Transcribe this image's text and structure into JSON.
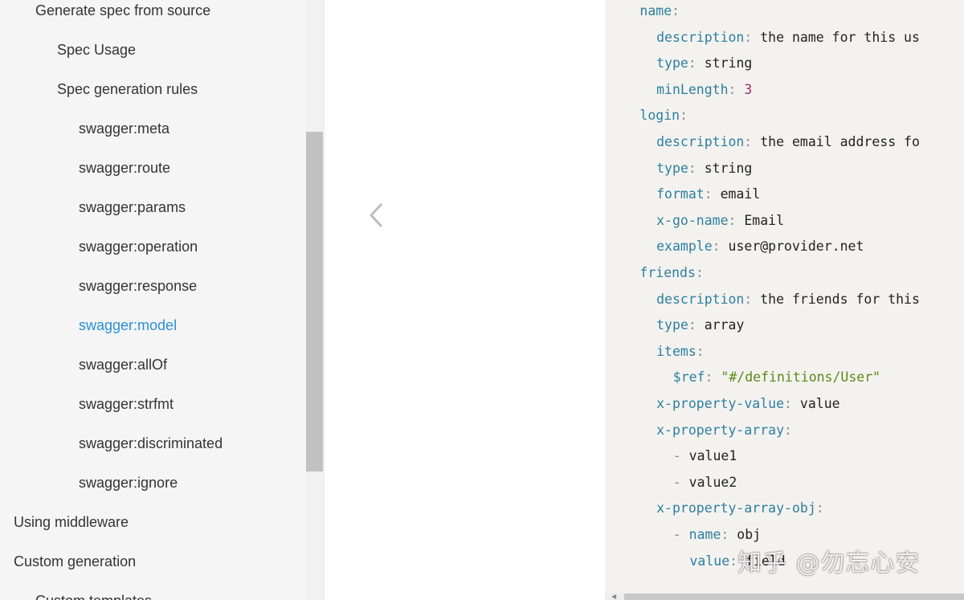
{
  "sidebar": {
    "items": [
      {
        "label": "Generate spec from source",
        "level": 2
      },
      {
        "label": "Spec Usage",
        "level": 3
      },
      {
        "label": "Spec generation rules",
        "level": 3
      },
      {
        "label": "swagger:meta",
        "level": 4
      },
      {
        "label": "swagger:route",
        "level": 4
      },
      {
        "label": "swagger:params",
        "level": 4
      },
      {
        "label": "swagger:operation",
        "level": 4
      },
      {
        "label": "swagger:response",
        "level": 4
      },
      {
        "label": "swagger:model",
        "level": 4,
        "active": true
      },
      {
        "label": "swagger:allOf",
        "level": 4
      },
      {
        "label": "swagger:strfmt",
        "level": 4
      },
      {
        "label": "swagger:discriminated",
        "level": 4
      },
      {
        "label": "swagger:ignore",
        "level": 4
      },
      {
        "label": "Using middleware",
        "level": 1
      },
      {
        "label": "Custom generation",
        "level": 1
      },
      {
        "label": "Custom templates",
        "level": 2
      }
    ]
  },
  "nav": {
    "prev_icon": "chevron-left-icon"
  },
  "code": {
    "lines": [
      {
        "indent": 4,
        "key": "name",
        "value": ""
      },
      {
        "indent": 6,
        "key": "description",
        "value": "the name for this us"
      },
      {
        "indent": 6,
        "key": "type",
        "value": "string"
      },
      {
        "indent": 6,
        "key": "minLength",
        "value": "3",
        "vtype": "num"
      },
      {
        "indent": 4,
        "key": "login",
        "value": ""
      },
      {
        "indent": 6,
        "key": "description",
        "value": "the email address fo"
      },
      {
        "indent": 6,
        "key": "type",
        "value": "string"
      },
      {
        "indent": 6,
        "key": "format",
        "value": "email"
      },
      {
        "indent": 6,
        "key": "x-go-name",
        "value": "Email"
      },
      {
        "indent": 6,
        "key": "example",
        "value": "user@provider.net"
      },
      {
        "indent": 4,
        "key": "friends",
        "value": ""
      },
      {
        "indent": 6,
        "key": "description",
        "value": "the friends for this"
      },
      {
        "indent": 6,
        "key": "type",
        "value": "array"
      },
      {
        "indent": 6,
        "key": "items",
        "value": ""
      },
      {
        "indent": 8,
        "key": "$ref",
        "value": "\"#/definitions/User\"",
        "vtype": "str"
      },
      {
        "indent": 6,
        "key": "x-property-value",
        "value": "value"
      },
      {
        "indent": 6,
        "key": "x-property-array",
        "value": ""
      },
      {
        "indent": 8,
        "dash": true,
        "value": "value1"
      },
      {
        "indent": 8,
        "dash": true,
        "value": "value2"
      },
      {
        "indent": 6,
        "key": "x-property-array-obj",
        "value": ""
      },
      {
        "indent": 8,
        "dash": true,
        "key": "name",
        "value": "obj"
      },
      {
        "indent": 10,
        "key": "value",
        "value": "field"
      }
    ]
  },
  "watermark": "知乎 @勿忘心安",
  "colors": {
    "accent": "#2a8fd8",
    "code_key": "#2c7fa0",
    "code_number": "#a0306a",
    "code_string": "#5a8a18",
    "code_bg": "#f4f2ef",
    "sidebar_bg": "#f5f5f5"
  }
}
